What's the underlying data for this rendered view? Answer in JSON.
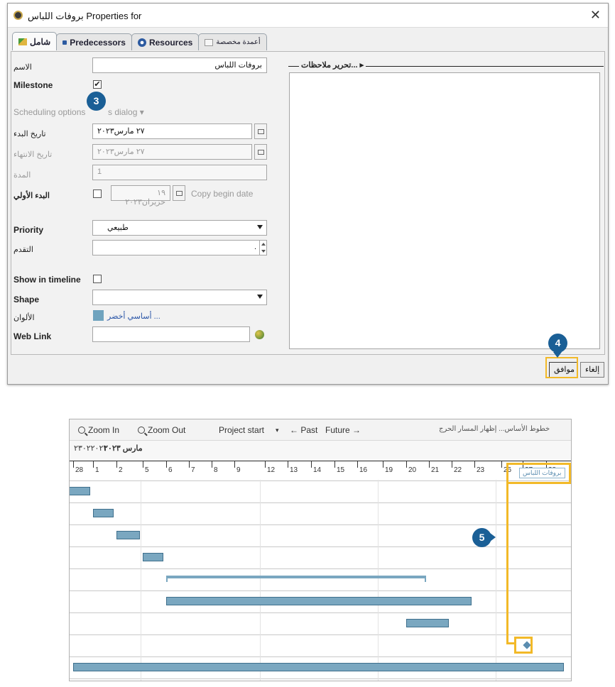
{
  "dialog": {
    "title": "بروفات اللباس Properties for",
    "close_glyph": "✕",
    "tabs": [
      "شامل",
      "Predecessors",
      "Resources",
      "أعمدة مخصصة"
    ],
    "fields": {
      "name_label": "الاسم",
      "name_value": "بروفات اللباس",
      "milestone_label": "Milestone",
      "milestone_checked": "✔",
      "scheduling_label": "Scheduling options",
      "scheduling_suffix": "s dialog ▾",
      "start_label": "تاريخ البدء",
      "start_value": "٢٧ مارس٢٠٢٣",
      "end_label": "تاريخ الانتهاء",
      "end_value": "٢٧ مارس٢٠٢٣",
      "duration_label": "المدة",
      "duration_value": "1",
      "early_start_label": "البدء الأولي",
      "early_start_value": "١٩ حزيران٢٠٢٣",
      "copy_begin": "Copy begin date",
      "priority_label": "Priority",
      "priority_value": "طبيعي",
      "progress_label": "التقدم",
      "progress_value": ".",
      "timeline_label": "Show in timeline",
      "shape_label": "Shape",
      "colors_label": "الألوان",
      "colors_value": "أساسي أخضر ...",
      "weblink_label": "Web Link"
    },
    "notes_title": "تحرير ملاحظات... ▸",
    "buttons": {
      "cancel": "إلغاء",
      "ok": "موافق"
    },
    "accent": "#1a5f96"
  },
  "badges": {
    "b3": "3",
    "b4": "4",
    "b5": "5"
  },
  "gantt": {
    "toolbar": {
      "zoom_in": "Zoom In",
      "zoom_out": "Zoom Out",
      "project_start": "Project start",
      "project_start_arrow": "▾",
      "past": "← Past",
      "future": "Future →",
      "right_text": "خطوط الأساس...  إظهار المسار الحرج"
    },
    "month_label": "مارس ٢٠٢٣",
    "month_code": "٢٣٠٢٢٠٢٣",
    "days": [
      "28",
      "1",
      "2",
      "5",
      "6",
      "7",
      "8",
      "9",
      "12",
      "13",
      "14",
      "15",
      "16",
      "19",
      "20",
      "21",
      "22",
      "23",
      "26",
      "27",
      "28"
    ],
    "milestone_label": "بروفات اللباس",
    "highlight_color": "#f2b928"
  },
  "chart_data": {
    "type": "gantt",
    "x_unit": "day of March 2023 (Feb 28 first)",
    "tasks": [
      {
        "row": 1,
        "start": "28",
        "end": "1"
      },
      {
        "row": 2,
        "start": "1",
        "end": "2"
      },
      {
        "row": 3,
        "start": "2",
        "end": "5"
      },
      {
        "row": 4,
        "start": "5",
        "end": "6"
      },
      {
        "row": 5,
        "type": "summary",
        "start": "6",
        "end": "21"
      },
      {
        "row": 6,
        "start": "6",
        "end": "23"
      },
      {
        "row": 7,
        "start": "20",
        "end": "22"
      },
      {
        "row": 8,
        "type": "milestone",
        "date": "27"
      },
      {
        "row": 9,
        "start": "28",
        "end": "29"
      }
    ]
  }
}
